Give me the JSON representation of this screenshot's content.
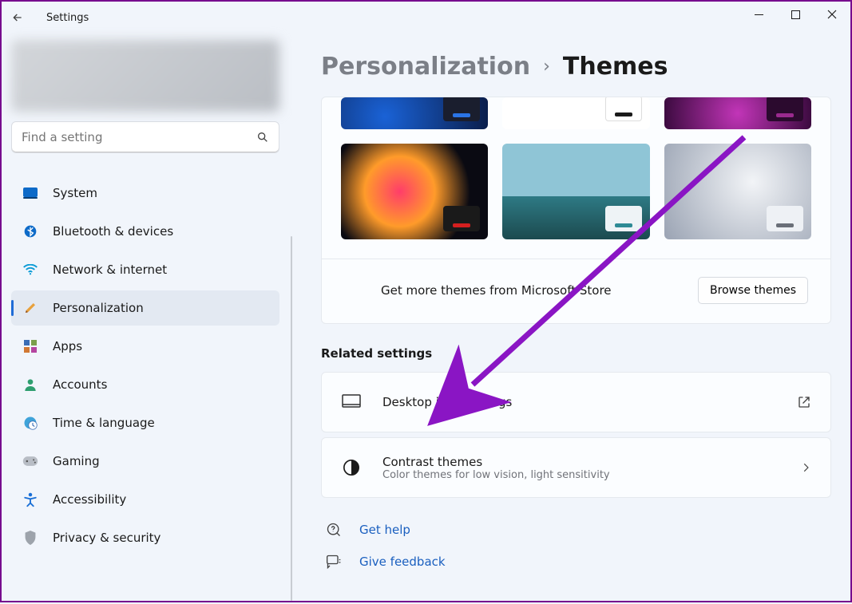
{
  "app_title": "Settings",
  "search_placeholder": "Find a setting",
  "nav": [
    {
      "key": "system",
      "label": "System"
    },
    {
      "key": "bluetooth",
      "label": "Bluetooth & devices"
    },
    {
      "key": "network",
      "label": "Network & internet"
    },
    {
      "key": "personalization",
      "label": "Personalization"
    },
    {
      "key": "apps",
      "label": "Apps"
    },
    {
      "key": "accounts",
      "label": "Accounts"
    },
    {
      "key": "time",
      "label": "Time & language"
    },
    {
      "key": "gaming",
      "label": "Gaming"
    },
    {
      "key": "accessibility",
      "label": "Accessibility"
    },
    {
      "key": "privacy",
      "label": "Privacy & security"
    }
  ],
  "breadcrumb": {
    "parent": "Personalization",
    "current": "Themes"
  },
  "store_row": {
    "text": "Get more themes from Microsoft Store",
    "button": "Browse themes"
  },
  "related_title": "Related settings",
  "rows": {
    "desktop_icon": {
      "title": "Desktop icon settings"
    },
    "contrast": {
      "title": "Contrast themes",
      "sub": "Color themes for low vision, light sensitivity"
    }
  },
  "help_links": {
    "get_help": "Get help",
    "feedback": "Give feedback"
  }
}
